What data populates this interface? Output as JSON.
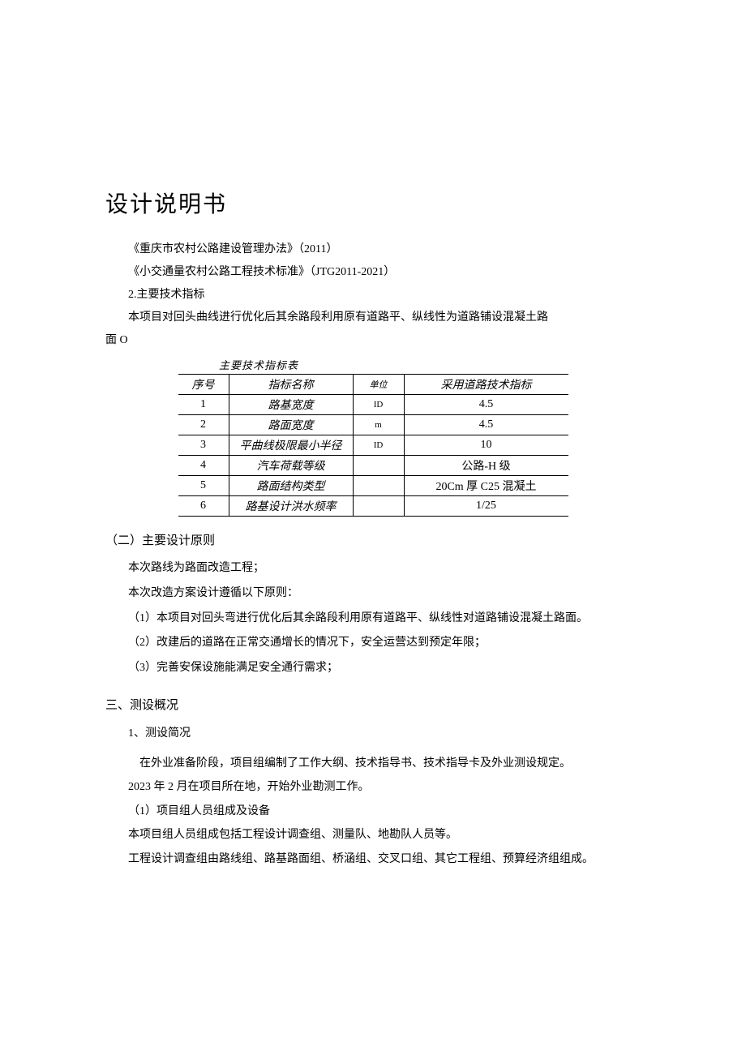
{
  "title": "设计说明书",
  "refs": {
    "r1": "《重庆市农村公路建设管理办法》（2011）",
    "r2": "《小交通量农村公路工程技术标准》（JTG2011-2021）"
  },
  "sec2": {
    "heading": "2.主要技术指标",
    "p1": "本项目对回头曲线进行优化后其余路段利用原有道路平、纵线性为道路铺设混凝土路",
    "p1_tail": "面 O"
  },
  "table": {
    "caption": "主要技术指标表",
    "headers": {
      "seq": "序号",
      "name": "指标名称",
      "unit": "单位",
      "val": "采用道路技术指标"
    },
    "rows": [
      {
        "seq": "1",
        "name": "路基宽度",
        "unit": "ID",
        "val": "4.5"
      },
      {
        "seq": "2",
        "name": "路面宽度",
        "unit": "m",
        "val": "4.5"
      },
      {
        "seq": "3",
        "name": "平曲线极限最小半径",
        "unit": "ID",
        "val": "10"
      },
      {
        "seq": "4",
        "name": "汽车荷载等级",
        "unit": "",
        "val": "公路-H 级"
      },
      {
        "seq": "5",
        "name": "路面结构类型",
        "unit": "",
        "val": "20Cm 厚 C25 混凝土"
      },
      {
        "seq": "6",
        "name": "路基设计洪水频率",
        "unit": "",
        "val": "1/25"
      }
    ]
  },
  "principles": {
    "heading": "（二）主要设计原则",
    "p1": "本次路线为路面改造工程；",
    "p2": "本次改造方案设计遵循以下原则：",
    "items": [
      "（1）本项目对回头弯进行优化后其余路段利用原有道路平、纵线性对道路铺设混凝土路面。",
      "（2）改建后的道路在正常交通增长的情况下，安全运营达到预定年限；",
      "（3）完善安保设施能满足安全通行需求；"
    ]
  },
  "survey": {
    "heading": "三、测设概况",
    "sub1": "1、测设简况",
    "p1": "在外业准备阶段，项目组编制了工作大纲、技术指导书、技术指导卡及外业测设规定。",
    "p2": "2023 年 2 月在项目所在地，开始外业勘测工作。",
    "p3": "（1）项目组人员组成及设备",
    "p4": "本项目组人员组成包括工程设计调查组、测量队、地勘队人员等。",
    "p5": "工程设计调查组由路线组、路基路面组、桥涵组、交叉口组、其它工程组、预算经济组组成。"
  }
}
